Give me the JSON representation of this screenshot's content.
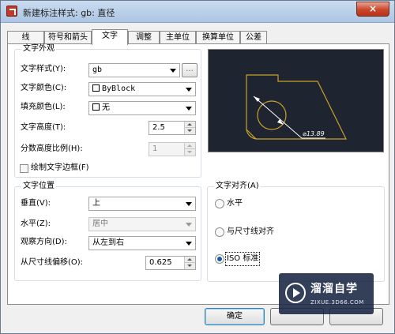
{
  "window": {
    "title": "新建标注样式: gb: 直径",
    "close_glyph": "×"
  },
  "tabs": [
    {
      "label": "线",
      "active": false
    },
    {
      "label": "符号和箭头",
      "active": false
    },
    {
      "label": "文字",
      "active": true
    },
    {
      "label": "调整",
      "active": false
    },
    {
      "label": "主单位",
      "active": false
    },
    {
      "label": "换算单位",
      "active": false
    },
    {
      "label": "公差",
      "active": false
    }
  ],
  "text_appearance": {
    "title": "文字外观",
    "style_label": "文字样式(Y):",
    "style_value": "gb",
    "style_button": "...",
    "color_label": "文字颜色(C):",
    "color_value": "ByBlock",
    "fill_label": "填充颜色(L):",
    "fill_value": "无",
    "height_label": "文字高度(T):",
    "height_value": "2.5",
    "fraction_label": "分数高度比例(H):",
    "fraction_value": "1",
    "frame_label": "绘制文字边框(F)",
    "frame_checked": false
  },
  "text_placement": {
    "title": "文字位置",
    "vertical_label": "垂直(V):",
    "vertical_value": "上",
    "horizontal_label": "水平(Z):",
    "horizontal_value": "居中",
    "view_dir_label": "观察方向(D):",
    "view_dir_value": "从左到右",
    "offset_label": "从尺寸线偏移(O):",
    "offset_value": "0.625"
  },
  "text_alignment": {
    "title": "文字对齐(A)",
    "options": [
      {
        "label": "水平",
        "checked": false
      },
      {
        "label": "与尺寸线对齐",
        "checked": false
      },
      {
        "label": "ISO 标准",
        "checked": true
      }
    ]
  },
  "preview": {
    "dimension_text": "⌀13.89",
    "colors": {
      "background": "#1e2430",
      "outline": "#c8a228",
      "dimension": "#ffffff"
    }
  },
  "buttons": {
    "ok": "确定"
  },
  "watermark": {
    "title": "溜溜自学",
    "url": "ZIXUE.3D66.COM"
  }
}
